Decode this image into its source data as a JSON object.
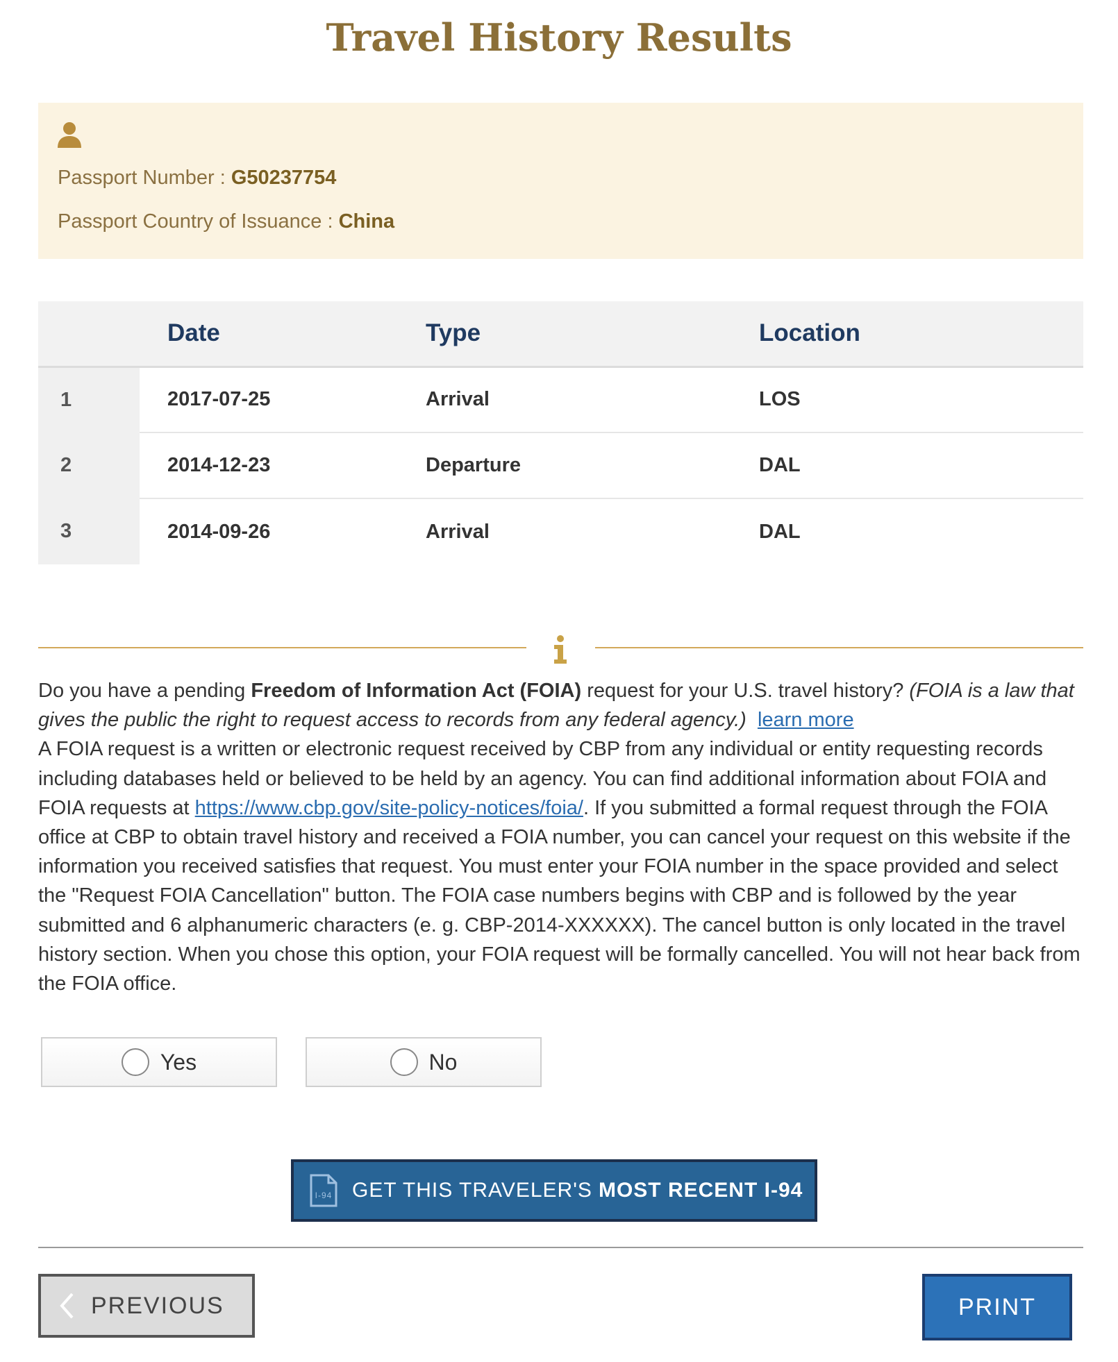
{
  "page": {
    "title": "Travel History Results"
  },
  "passport": {
    "icon": "person-icon",
    "number_label": "Passport Number : ",
    "number_value": "G50237754",
    "country_label": "Passport Country of Issuance : ",
    "country_value": "China"
  },
  "history": {
    "columns": [
      "",
      "Date",
      "Type",
      "Location"
    ],
    "rows": [
      {
        "index": "1",
        "date": "2017-07-25",
        "type": "Arrival",
        "location": "LOS"
      },
      {
        "index": "2",
        "date": "2014-12-23",
        "type": "Departure",
        "location": "DAL"
      },
      {
        "index": "3",
        "date": "2014-09-26",
        "type": "Arrival",
        "location": "DAL"
      }
    ]
  },
  "foia": {
    "icon": "info-icon",
    "q_prefix": "Do you have a pending ",
    "q_bold": "Freedom of Information Act (FOIA)",
    "q_suffix": " request for your U.S. travel history? ",
    "q_italic": "(FOIA is a law that gives the public the right to request access to records from any federal agency.)",
    "learn_more": "learn more",
    "body_1": "A FOIA request is a written or electronic request received by CBP from any individual or entity requesting records including databases held or believed to be held by an agency. You can find additional information about FOIA and FOIA requests at ",
    "link": "https://www.cbp.gov/site-policy-notices/foia/",
    "body_2": ". If you submitted a formal request through the FOIA office at CBP to obtain travel history and received a FOIA number, you can cancel your request on this website if the information you received satisfies that request. You must enter your FOIA number in the space provided and select the \"Request FOIA Cancellation\" button. The FOIA case numbers begins with CBP and is followed by the year submitted and 6 alphanumeric characters (e. g. CBP-2014-XXXXXX). The cancel button is only located in the travel history section. When you chose this option, your FOIA request will be formally cancelled. You will not hear back from the FOIA office.",
    "options": {
      "yes": "Yes",
      "no": "No"
    }
  },
  "actions": {
    "i94_icon_text": "I-94",
    "i94_prefix": "GET THIS TRAVELER'S",
    "i94_bold": "MOST RECENT I-94",
    "previous": "PREVIOUS",
    "print": "PRINT"
  },
  "colors": {
    "title": "#8b6f38",
    "passport_bg": "#fbf3e1",
    "table_header_text": "#1f3a60",
    "divider_gold": "#d3a85a",
    "link": "#2a6cb0",
    "i94_bg": "#286496",
    "print_bg": "#2c72b8"
  }
}
